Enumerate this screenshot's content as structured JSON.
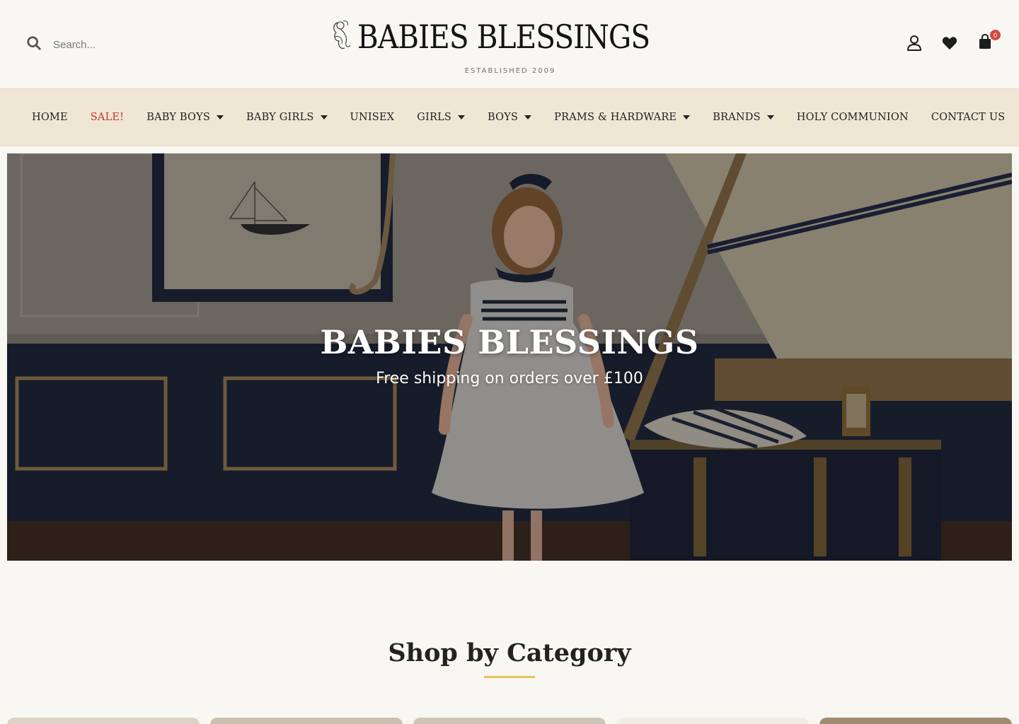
{
  "header": {
    "search_placeholder": "Search...",
    "logo_text": "BABIES BLESSINGS",
    "logo_tagline": "ESTABLISHED 2009",
    "cart_count": "0"
  },
  "nav": {
    "items": [
      {
        "label": "HOME",
        "dropdown": false
      },
      {
        "label": "SALE!",
        "dropdown": false
      },
      {
        "label": "BABY BOYS",
        "dropdown": true
      },
      {
        "label": "BABY GIRLS",
        "dropdown": true
      },
      {
        "label": "UNISEX",
        "dropdown": false
      },
      {
        "label": "GIRLS",
        "dropdown": true
      },
      {
        "label": "BOYS",
        "dropdown": true
      },
      {
        "label": "PRAMS & HARDWARE",
        "dropdown": true
      },
      {
        "label": "BRANDS",
        "dropdown": true
      },
      {
        "label": "HOLY COMMUNION",
        "dropdown": false
      },
      {
        "label": "CONTACT US",
        "dropdown": false
      }
    ]
  },
  "hero": {
    "title": "BABIES BLESSINGS",
    "subtitle": "Free shipping on orders over £100"
  },
  "categories": {
    "title": "Shop by Category",
    "accent_color": "#e8c15b"
  },
  "colors": {
    "background": "#f9f7f2",
    "nav_background": "#efe6d4",
    "sale": "#c7362b",
    "badge": "#d5483e"
  },
  "icons": [
    "search-icon",
    "logo-emblem-icon",
    "user-icon",
    "heart-icon",
    "shopping-bag-icon"
  ]
}
